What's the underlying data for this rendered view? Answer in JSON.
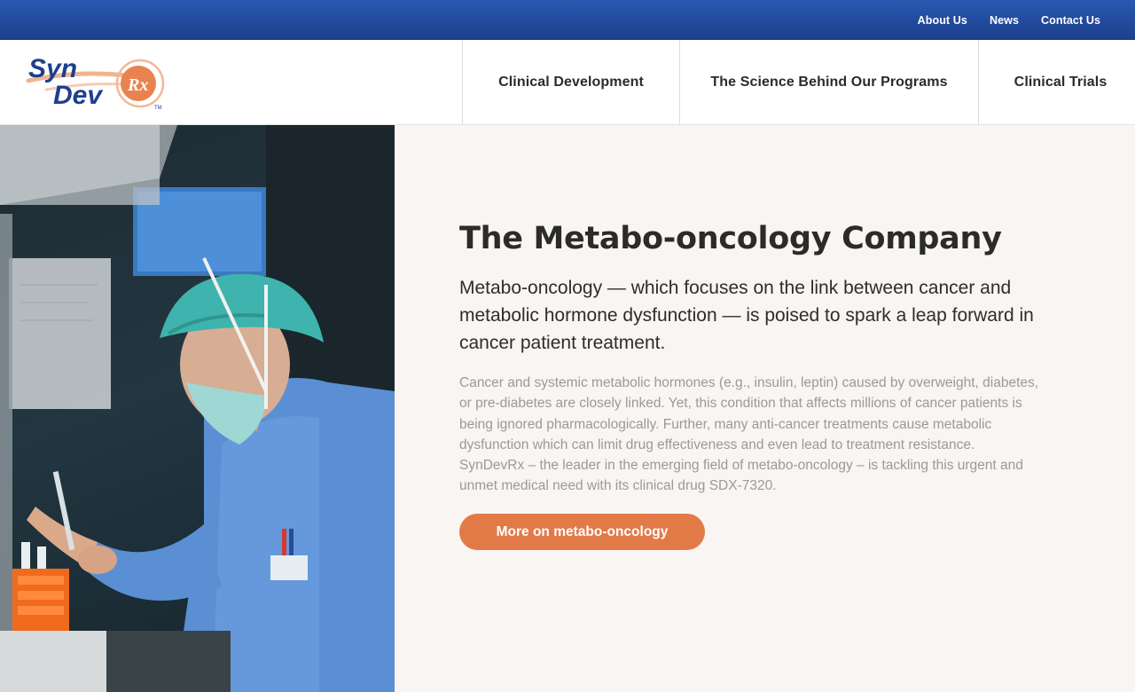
{
  "topbar": {
    "links": [
      "About Us",
      "News",
      "Contact Us"
    ]
  },
  "brand": {
    "logo_word_1": "Syn",
    "logo_word_2": "Dev",
    "logo_badge": "Rx",
    "trademark": "TM",
    "colors": {
      "navy": "#1e3f8f",
      "orange": "#e27a48"
    }
  },
  "nav": {
    "items": [
      "Clinical Development",
      "The Science Behind Our Programs",
      "Clinical Trials"
    ]
  },
  "hero": {
    "image_icon": "lab-researcher-photo",
    "title": "The Metabo-oncology Company",
    "lead": "Metabo-oncology — which focuses on the link between cancer and metabolic hormone dysfunction — is poised to spark a leap forward in cancer patient treatment.",
    "body_1": "Cancer and systemic metabolic hormones (e.g., insulin, leptin) caused by overweight, diabetes, or pre-diabetes are closely linked.  Yet, this condition that affects millions of cancer patients is being ignored pharmacologically. Further, many anti-cancer treatments cause metabolic dysfunction which can limit drug effectiveness and even lead to treatment resistance.",
    "body_2": "SynDevRx – the leader in the emerging  field of metabo-oncology – is tackling this urgent and unmet medical need with its clinical drug SDX-7320.",
    "cta_label": "More on metabo-oncology"
  }
}
